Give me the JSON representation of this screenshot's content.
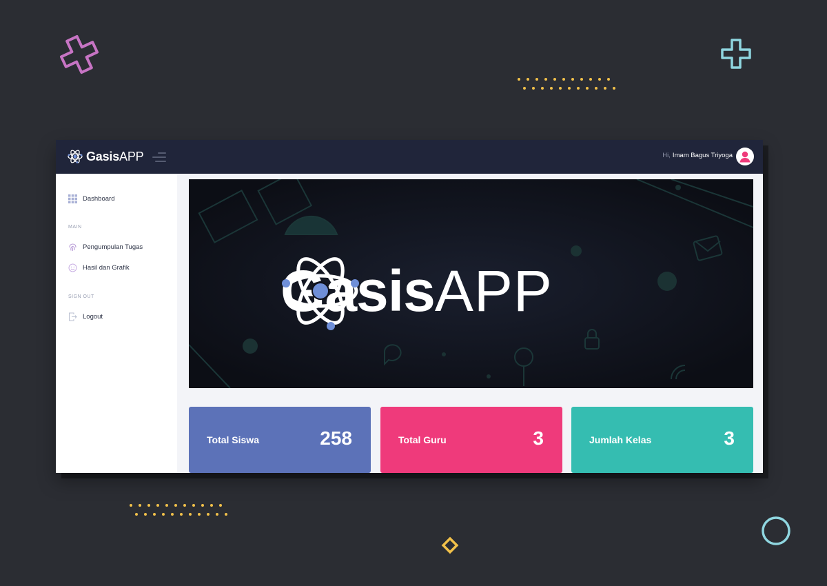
{
  "app": {
    "brand_bold": "Gasis",
    "brand_light": "APP"
  },
  "header": {
    "greeting_prefix": "Hi,",
    "user_name": "Imam Bagus Triyoga",
    "avatar_icon": "user-avatar-icon"
  },
  "sidebar": {
    "dashboard": {
      "label": "Dashboard",
      "icon": "grid-icon"
    },
    "main_heading": "MAIN",
    "items": [
      {
        "label": "Pengumpulan Tugas",
        "icon": "fingerprint-icon"
      },
      {
        "label": "Hasil dan Grafik",
        "icon": "smile-icon"
      }
    ],
    "signout_heading": "SIGN OUT",
    "logout": {
      "label": "Logout",
      "icon": "logout-icon"
    }
  },
  "banner": {
    "title_bold": "Gasis",
    "title_light": "APP"
  },
  "cards": [
    {
      "label": "Total Siswa",
      "value": "258",
      "color": "#5c72b8"
    },
    {
      "label": "Total Guru",
      "value": "3",
      "color": "#ef3a7b"
    },
    {
      "label": "Jumlah Kelas",
      "value": "3",
      "color": "#35bdb1"
    }
  ],
  "colors": {
    "background": "#2b2d33",
    "topbar": "#20253a",
    "accent_pink": "#ef3a7b",
    "accent_teal": "#35bdb1",
    "accent_blue": "#5c72b8",
    "decor_yellow": "#f2c14a",
    "decor_purple": "#c774c4",
    "decor_cyan": "#8fd6e0"
  }
}
